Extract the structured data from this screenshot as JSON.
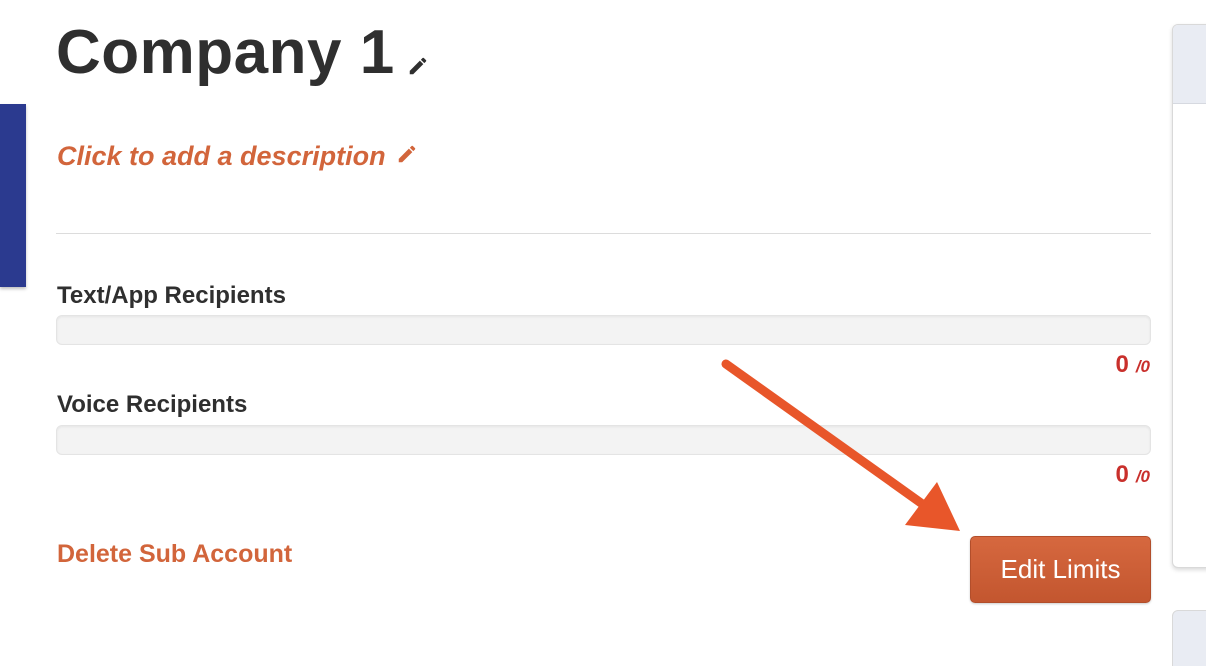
{
  "header": {
    "title": "Company 1",
    "edit_icon": "pencil-icon"
  },
  "description": {
    "placeholder_text": "Click to add a description",
    "edit_icon": "pencil-icon"
  },
  "usage": [
    {
      "label": "Text/App Recipients",
      "used": "0",
      "limit": "/0",
      "progress": 0
    },
    {
      "label": "Voice Recipients",
      "used": "0",
      "limit": "/0",
      "progress": 0
    }
  ],
  "actions": {
    "delete_label": "Delete Sub Account",
    "edit_limits_label": "Edit Limits"
  },
  "colors": {
    "accent": "#d2653b",
    "count_red": "#c9302c",
    "side_tab": "#2b3a8f",
    "annotation_arrow": "#e8562a"
  }
}
